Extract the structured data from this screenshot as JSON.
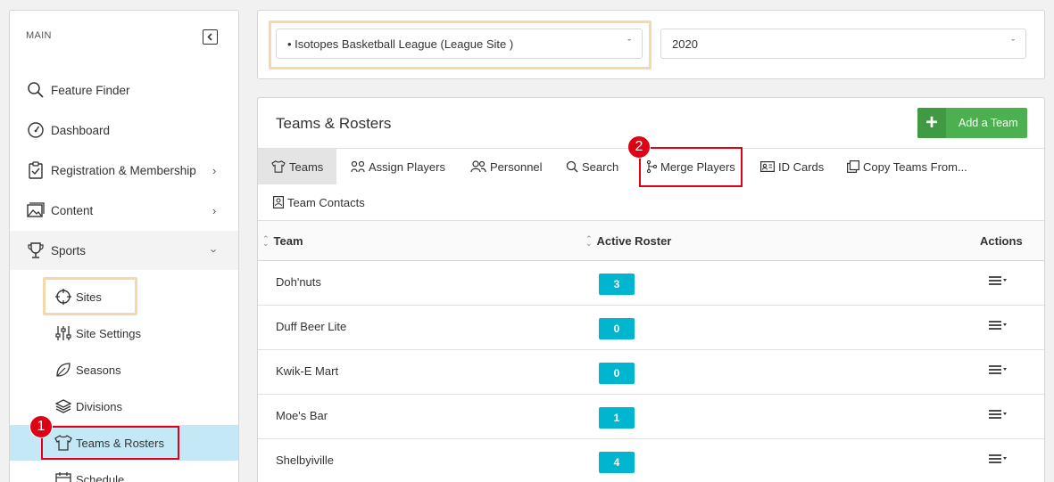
{
  "sidebar": {
    "header": "MAIN",
    "items": [
      {
        "label": "Feature Finder",
        "icon": "search-icon"
      },
      {
        "label": "Dashboard",
        "icon": "speedometer-icon"
      },
      {
        "label": "Registration & Membership",
        "icon": "clipboard-icon"
      },
      {
        "label": "Content",
        "icon": "image-icon"
      },
      {
        "label": "Sports",
        "icon": "trophy-icon"
      }
    ],
    "sub_items": [
      {
        "label": "Sites",
        "icon": "crosshair-icon"
      },
      {
        "label": "Site Settings",
        "icon": "sliders-icon"
      },
      {
        "label": "Seasons",
        "icon": "leaf-icon"
      },
      {
        "label": "Divisions",
        "icon": "layers-icon"
      },
      {
        "label": "Teams & Rosters",
        "icon": "shirt-icon"
      },
      {
        "label": "Schedule",
        "icon": "calendar-icon"
      }
    ]
  },
  "filters": {
    "site": "• Isotopes Basketball League (League Site )",
    "year": "2020"
  },
  "main": {
    "title": "Teams & Rosters",
    "add_button": "Add a Team",
    "tabs": [
      {
        "label": "Teams",
        "icon": "shirt-icon"
      },
      {
        "label": "Assign Players",
        "icon": "link-icon"
      },
      {
        "label": "Personnel",
        "icon": "people-icon"
      },
      {
        "label": "Search",
        "icon": "search-icon"
      },
      {
        "label": "Merge Players",
        "icon": "merge-icon"
      },
      {
        "label": "ID Cards",
        "icon": "id-card-icon"
      },
      {
        "label": "Copy Teams From...",
        "icon": "copy-icon"
      },
      {
        "label": "Team Contacts",
        "icon": "contact-icon"
      }
    ],
    "columns": {
      "team": "Team",
      "roster": "Active Roster",
      "actions": "Actions"
    },
    "rows": [
      {
        "team": "Doh'nuts",
        "roster": "3"
      },
      {
        "team": "Duff Beer Lite",
        "roster": "0"
      },
      {
        "team": "Kwik-E Mart",
        "roster": "0"
      },
      {
        "team": "Moe's Bar",
        "roster": "1"
      },
      {
        "team": "Shelbyiville",
        "roster": "4"
      }
    ]
  },
  "annotations": {
    "step1": "1",
    "step2": "2"
  },
  "colors": {
    "accent_green": "#4caf50",
    "roster_badge": "#00b5cf",
    "selected_bg": "#c5e8f7",
    "highlight_red": "#e0001a",
    "highlight_orange": "#f6d7a8"
  }
}
